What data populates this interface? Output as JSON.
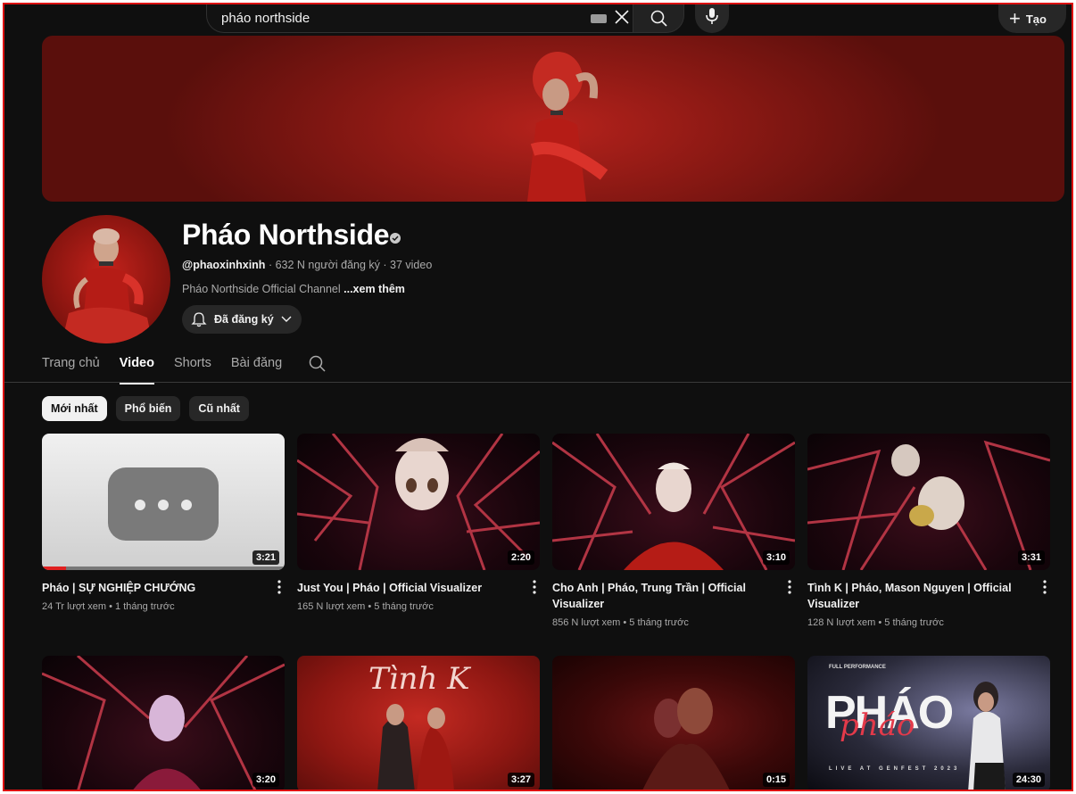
{
  "search": {
    "query": "pháo northside"
  },
  "header": {
    "create_label": "Tạo"
  },
  "channel": {
    "name": "Pháo Northside",
    "handle": "@phaoxinhxinh",
    "subscribers": "632 N người đăng ký",
    "video_count": "37 video",
    "description": "Pháo Northside Official Channel",
    "more_label": "...xem thêm",
    "subscribed_label": "Đã đăng ký"
  },
  "tabs": [
    {
      "label": "Trang chủ"
    },
    {
      "label": "Video"
    },
    {
      "label": "Shorts"
    },
    {
      "label": "Bài đăng"
    }
  ],
  "active_tab": "Video",
  "chips": [
    {
      "label": "Mới nhất"
    },
    {
      "label": "Phổ biến"
    },
    {
      "label": "Cũ nhất"
    }
  ],
  "videos": [
    {
      "title": "Pháo | SỰ NGHIỆP CHƯỚNG",
      "views": "24 Tr lượt xem",
      "age": "1 tháng trước",
      "duration": "3:21",
      "watched_fraction": 0.1
    },
    {
      "title": "Just You | Pháo | Official Visualizer",
      "views": "165 N lượt xem",
      "age": "5 tháng trước",
      "duration": "2:20"
    },
    {
      "title": "Cho Anh | Pháo, Trung Trần | Official Visualizer",
      "views": "856 N lượt xem",
      "age": "5 tháng trước",
      "duration": "3:10"
    },
    {
      "title": "Tình K | Pháo, Mason Nguyen | Official Visualizer",
      "views": "128 N lượt xem",
      "age": "5 tháng trước",
      "duration": "3:31"
    },
    {
      "title": "",
      "views": "",
      "age": "",
      "duration": "3:20"
    },
    {
      "title": "",
      "views": "",
      "age": "",
      "duration": "3:27"
    },
    {
      "title": "",
      "views": "",
      "age": "",
      "duration": "0:15"
    },
    {
      "title": "",
      "views": "",
      "age": "",
      "duration": "24:30"
    }
  ],
  "thumb_text": {
    "tinh_k": "Tình K",
    "live_top": "FULL PERFORMANCE",
    "live_logo": "PHÁO",
    "live_script": "pháo",
    "live_bottom": "LIVE AT GENFEST 2023"
  },
  "colors": {
    "background": "#0f0f0f",
    "accent_red": "#e02020",
    "banner_red": "#8c1914"
  }
}
